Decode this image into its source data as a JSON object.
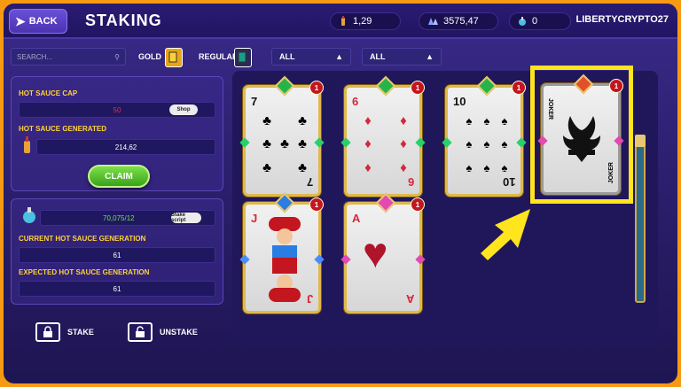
{
  "header": {
    "back_label": "BACK",
    "title": "STAKING",
    "stats": [
      {
        "icon": "hot-sauce-bottle-icon",
        "value": "1,29"
      },
      {
        "icon": "crystals-icon",
        "value": "3575,47"
      },
      {
        "icon": "potion-icon",
        "value": "0"
      }
    ],
    "username": "LIBERTYCRYPTO27"
  },
  "filters": {
    "search_placeholder": "SEARCH...",
    "gold_label": "GOLD",
    "regular_label": "REGULAR",
    "dropdown1": "ALL",
    "dropdown2": "ALL"
  },
  "sauce_panel": {
    "cap_label": "HOT SAUCE CAP",
    "cap_value": "50",
    "shop_button": "Shop",
    "generated_label": "HOT SAUCE GENERATED",
    "generated_value": "214,62",
    "claim_button": "CLAIM"
  },
  "gen_panel": {
    "potion_value": "70,075/12",
    "stake_script_button": "Stake script",
    "current_label": "CURRENT HOT SAUCE GENERATION",
    "current_value": "61",
    "expected_label": "EXPECTED HOT SAUCE GENERATION",
    "expected_value": "61"
  },
  "actions": {
    "stake_label": "STAKE",
    "unstake_label": "UNSTAKE"
  },
  "cards": [
    {
      "rank": "7",
      "suit": "♣",
      "color": "black",
      "count": "1",
      "gem": "#26b34a"
    },
    {
      "rank": "6",
      "suit": "♦",
      "color": "red",
      "count": "1",
      "gem": "#26b34a"
    },
    {
      "rank": "10",
      "suit": "♠",
      "color": "black",
      "count": "1",
      "gem": "#26b34a"
    },
    {
      "rank": "JOKER",
      "suit": "",
      "color": "black",
      "count": "1",
      "gem": "#e2502a"
    },
    {
      "rank": "J",
      "suit": "♦",
      "color": "red",
      "count": "1",
      "gem": "#2a7de2"
    },
    {
      "rank": "A",
      "suit": "♥",
      "color": "red",
      "count": "1",
      "gem": "#e24ab0"
    }
  ],
  "colors": {
    "accent_yellow": "#ffe41e",
    "claim_green": "#38a21a",
    "orange_bg": "#f59a12"
  }
}
